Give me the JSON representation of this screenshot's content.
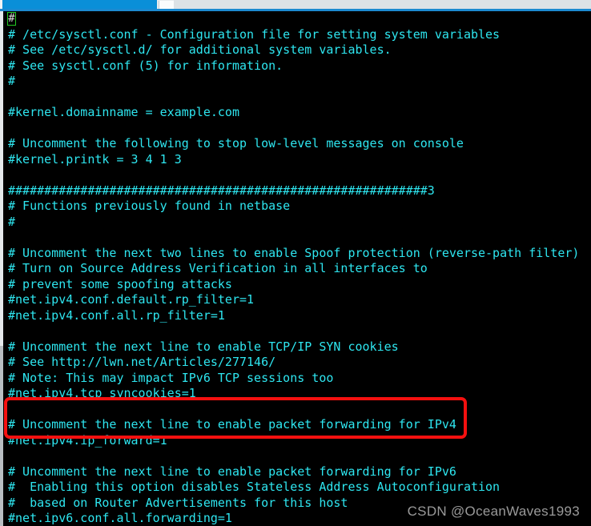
{
  "window": {
    "chrome_accent_color": "#0a8fd8",
    "terminal_background": "#000000",
    "terminal_text_color": "#2ee6f0"
  },
  "cursor": {
    "character": "#",
    "outline_color": "#22c722"
  },
  "highlight": {
    "color": "#f5100f",
    "label": "ipv4-forward-highlight"
  },
  "watermark": {
    "text": "CSDN @OceanWaves1993",
    "color": "#9a9a9a"
  },
  "editor": {
    "filename": "/etc/sysctl.conf",
    "lines": [
      "",
      "# /etc/sysctl.conf - Configuration file for setting system variables",
      "# See /etc/sysctl.d/ for additional system variables.",
      "# See sysctl.conf (5) for information.",
      "#",
      "",
      "#kernel.domainname = example.com",
      "",
      "# Uncomment the following to stop low-level messages on console",
      "#kernel.printk = 3 4 1 3",
      "",
      "##########################################################3",
      "# Functions previously found in netbase",
      "#",
      "",
      "# Uncomment the next two lines to enable Spoof protection (reverse-path filter)",
      "# Turn on Source Address Verification in all interfaces to",
      "# prevent some spoofing attacks",
      "#net.ipv4.conf.default.rp_filter=1",
      "#net.ipv4.conf.all.rp_filter=1",
      "",
      "# Uncomment the next line to enable TCP/IP SYN cookies",
      "# See http://lwn.net/Articles/277146/",
      "# Note: This may impact IPv6 TCP sessions too",
      "#net.ipv4.tcp_syncookies=1",
      "",
      "# Uncomment the next line to enable packet forwarding for IPv4",
      "#net.ipv4.ip_forward=1",
      "",
      "# Uncomment the next line to enable packet forwarding for IPv6",
      "#  Enabling this option disables Stateless Address Autoconfiguration",
      "#  based on Router Advertisements for this host",
      "#net.ipv6.conf.all.forwarding=1"
    ]
  }
}
